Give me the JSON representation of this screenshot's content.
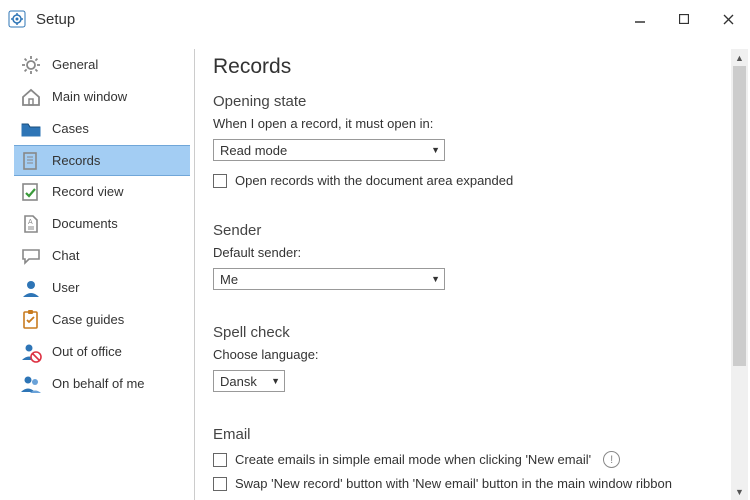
{
  "window": {
    "title": "Setup"
  },
  "sidebar": {
    "items": [
      {
        "label": "General"
      },
      {
        "label": "Main window"
      },
      {
        "label": "Cases"
      },
      {
        "label": "Records"
      },
      {
        "label": "Record view"
      },
      {
        "label": "Documents"
      },
      {
        "label": "Chat"
      },
      {
        "label": "User"
      },
      {
        "label": "Case guides"
      },
      {
        "label": "Out of office"
      },
      {
        "label": "On behalf of me"
      }
    ],
    "selected_index": 3
  },
  "page": {
    "title": "Records",
    "opening_state": {
      "heading": "Opening state",
      "prompt": "When I open a record, it must open in:",
      "mode_value": "Read mode",
      "expand_label": "Open records with the document area expanded",
      "expand_checked": false
    },
    "sender": {
      "heading": "Sender",
      "prompt": "Default sender:",
      "value": "Me"
    },
    "spell_check": {
      "heading": "Spell check",
      "prompt": "Choose language:",
      "value": "Dansk"
    },
    "email": {
      "heading": "Email",
      "simple_mode_label": "Create emails in simple email mode when clicking 'New email'",
      "swap_button_label": "Swap 'New record' button with 'New email' button in the main window ribbon"
    }
  }
}
